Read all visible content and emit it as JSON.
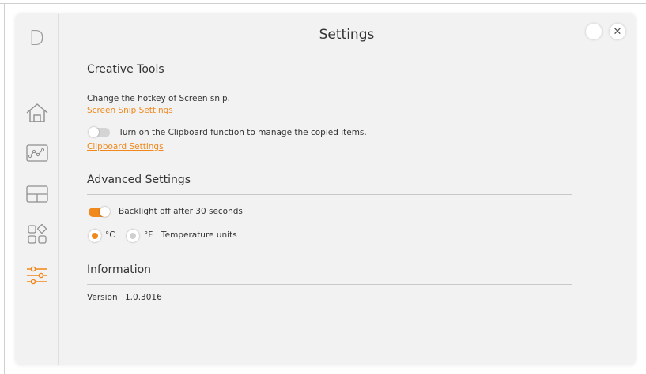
{
  "app": {
    "logo": "D",
    "title": "Settings",
    "accent_color": "#f0881b",
    "window_controls": [
      "minimize-icon",
      "close-icon"
    ]
  },
  "sidebar": {
    "items": [
      {
        "icon": "home-icon",
        "active": false
      },
      {
        "icon": "chart-icon",
        "active": false
      },
      {
        "icon": "layout-icon",
        "active": false
      },
      {
        "icon": "apps-icon",
        "active": false
      },
      {
        "icon": "sliders-icon",
        "active": true
      }
    ]
  },
  "creative_tools": {
    "heading": "Creative Tools",
    "hotkey_text": "Change the hotkey of Screen snip.",
    "screen_snip_link": "Screen Snip Settings",
    "clipboard_toggle_label": "Turn on the Clipboard function to manage the copied items.",
    "clipboard_toggle_on": false,
    "clipboard_link": "Clipboard Settings"
  },
  "advanced_settings": {
    "heading": "Advanced Settings",
    "backlight_label": "Backlight off after 30 seconds",
    "backlight_on": true,
    "temp_celsius_label": "°C",
    "temp_fahrenheit_label": "°F",
    "temp_units_label": "Temperature units",
    "temp_selected": "°C"
  },
  "information": {
    "heading": "Information",
    "version_label": "Version",
    "version_value": "1.0.3016"
  }
}
